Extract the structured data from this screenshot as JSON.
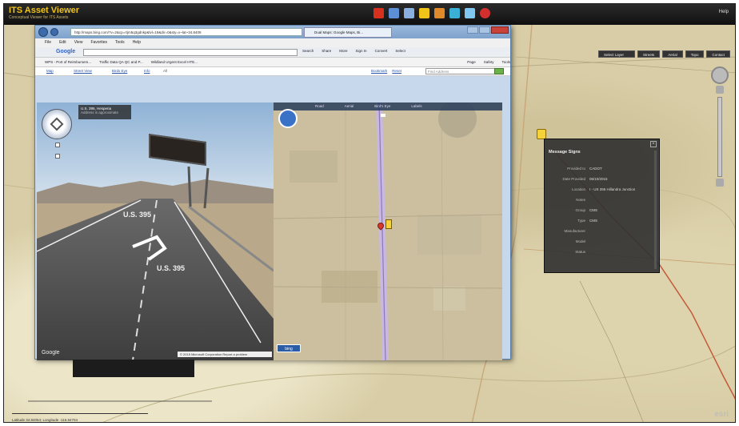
{
  "app": {
    "title": "ITS Asset Viewer",
    "subtitle": "Conceptual Viewer for ITS Assets",
    "header_right": "Help"
  },
  "toolbar": {
    "icons": [
      {
        "name": "flag-icon",
        "color": "#d7301f"
      },
      {
        "name": "layers-icon",
        "color": "#5c8fd6"
      },
      {
        "name": "table-icon",
        "color": "#8ab0e0"
      },
      {
        "name": "pencil-icon",
        "color": "#f0c419"
      },
      {
        "name": "globe-icon",
        "color": "#e08a2c"
      },
      {
        "name": "measure-icon",
        "color": "#3bb0d6"
      },
      {
        "name": "camera-icon",
        "color": "#7fc7f0"
      },
      {
        "name": "stop-icon",
        "color": "#d32f2f"
      }
    ]
  },
  "map": {
    "tabs": [
      "Select Layer",
      "Streets",
      "Aerial",
      "Topo",
      "Contact"
    ],
    "coordinates": "Latitude 34.84054; Longitude -116.84704",
    "esri_logo": "esri"
  },
  "popup": {
    "title": "Message Signs",
    "rows": [
      {
        "key": "Provided to",
        "value": "CADOT"
      },
      {
        "key": "Date Provided",
        "value": "06/10/2015"
      },
      {
        "key": "Location",
        "value": "I - US 395 Hillandra Junction"
      },
      {
        "key": "Notes",
        "value": ""
      },
      {
        "key": "Group",
        "value": "CMS"
      },
      {
        "key": "Type",
        "value": "CMS"
      },
      {
        "key": "Manufacturer",
        "value": ""
      },
      {
        "key": "Model",
        "value": ""
      },
      {
        "key": "Status",
        "value": ""
      }
    ]
  },
  "browser": {
    "url": "http://maps.bing.com/?v=2&cp=rtjm5q3gdnkp&lvl=19&dir=0&sty=x~lat~34.8409",
    "tab_title": "Dual Maps: Google Maps, Bi...",
    "menu": [
      "File",
      "Edit",
      "View",
      "Favorites",
      "Tools",
      "Help"
    ],
    "google_label": "Google",
    "google_items": [
      "Search",
      "Share",
      "More",
      "Sign In",
      "Convert",
      "Select"
    ],
    "favorites": [
      "WPS - Port of Reimbursem...",
      "Traffic Data QA QC and P...",
      "Wildland Urgent Excel HTE..."
    ],
    "fav_right": [
      "Page",
      "Safety",
      "Tools"
    ],
    "page_tabs": [
      "Map",
      "Street View",
      "Birds Eye",
      "Info"
    ],
    "page_tab_extra": "All",
    "addr_links": [
      "Bookmark",
      "Reset"
    ],
    "addr_placeholder": "Find Address",
    "aerial_tabs": [
      "Road",
      "Aerial",
      "Bird's Eye",
      "Labels"
    ]
  },
  "street_view": {
    "location_title": "U.S. 395, Hesperia",
    "location_sub": "Address is approximate",
    "road_text_1": "U.S. 395",
    "road_text_2": "U.S. 395",
    "google_mark": "Google"
  },
  "aerial_view": {
    "bing_logo": "bing",
    "status": "© 2015 Microsoft Corporation  Report a problem"
  }
}
